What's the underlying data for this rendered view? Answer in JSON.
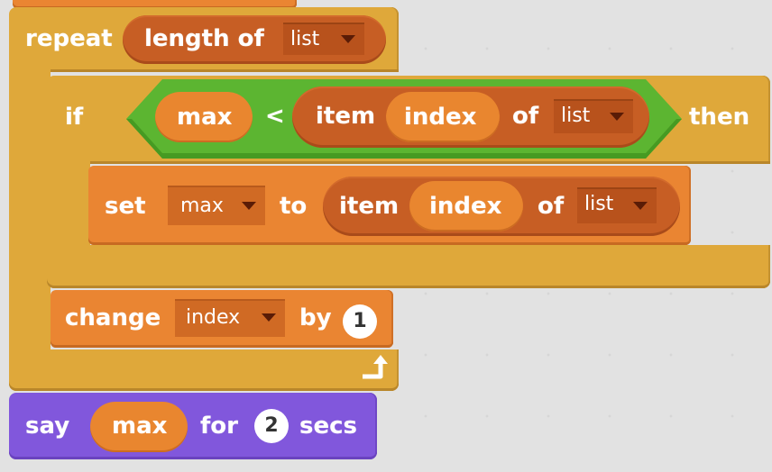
{
  "script": {
    "repeat": {
      "label": "repeat",
      "reporter": {
        "label": "length of",
        "list": "list"
      }
    },
    "if": {
      "label": "if",
      "then_label": "then",
      "condition": {
        "left": "max",
        "operator": "<",
        "right": {
          "item_label": "item",
          "index": "index",
          "of_label": "of",
          "list": "list"
        }
      }
    },
    "set": {
      "label": "set",
      "variable": "max",
      "to_label": "to",
      "value": {
        "item_label": "item",
        "index": "index",
        "of_label": "of",
        "list": "list"
      }
    },
    "change": {
      "label": "change",
      "variable": "index",
      "by_label": "by",
      "amount": "1"
    },
    "say": {
      "label": "say",
      "message": "max",
      "for_label": "for",
      "duration": "2",
      "secs_label": "secs"
    }
  },
  "colors": {
    "control": "#dfa83a",
    "data": "#ea8532",
    "data_dark": "#c75e24",
    "operators": "#5cb531",
    "looks": "#8157dc",
    "canvas": "#e2e2e2"
  }
}
